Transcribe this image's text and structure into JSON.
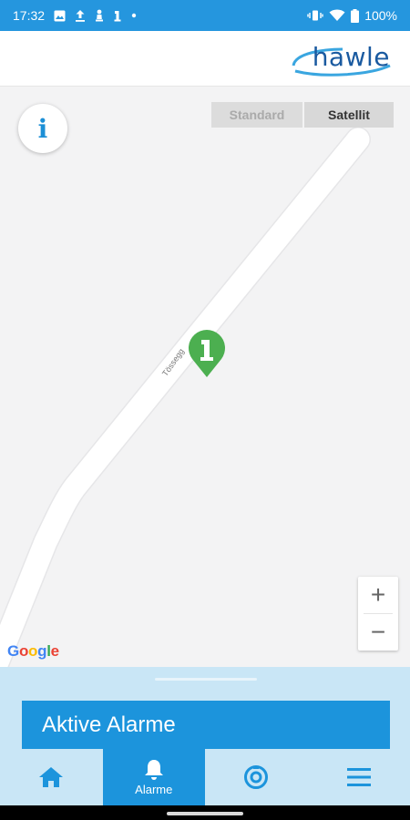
{
  "status_bar": {
    "time": "17:32",
    "battery": "100%",
    "icons_left": [
      "image-icon",
      "upload-icon",
      "chess-icon",
      "hydrant-icon",
      "dot-icon"
    ],
    "icons_right": [
      "vibrate-icon",
      "wifi-icon",
      "battery-icon"
    ],
    "color": "#2596de"
  },
  "header": {
    "logo": "hawle"
  },
  "map": {
    "info_label": "i",
    "map_types": {
      "standard": "Standard",
      "satellit": "Satellit",
      "selected": "Satellit"
    },
    "street_label": "Tössegg",
    "zoom": {
      "in": "+",
      "out": "−"
    },
    "provider": [
      "G",
      "o",
      "o",
      "g",
      "l",
      "e"
    ],
    "provider_colors": [
      "#4285F4",
      "#EA4335",
      "#FBBC05",
      "#4285F4",
      "#34A853",
      "#EA4335"
    ],
    "marker_color": "#4caf50",
    "marker_label": "1"
  },
  "sheet": {
    "title": "Aktive Alarme"
  },
  "bottom_nav": {
    "items": [
      {
        "icon": "home-icon",
        "label": ""
      },
      {
        "icon": "bell-icon",
        "label": "Alarme",
        "active": true
      },
      {
        "icon": "hydrant-top-icon",
        "label": ""
      },
      {
        "icon": "menu-icon",
        "label": ""
      }
    ]
  },
  "colors": {
    "accent": "#1c94dc",
    "sheet_bg": "#c9e6f6"
  }
}
